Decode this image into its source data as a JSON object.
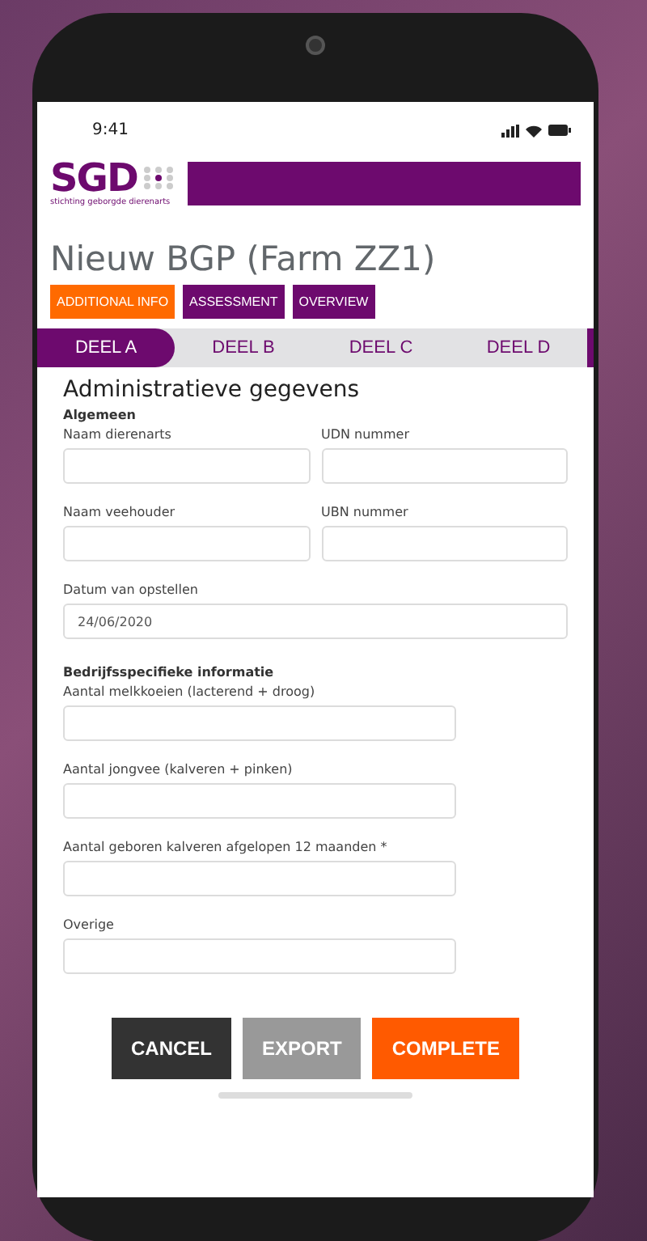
{
  "status_bar": {
    "time": "9:41"
  },
  "logo": {
    "text": "SGD",
    "subtitle": "stichting geborgde dierenarts"
  },
  "title": "Nieuw BGP (Farm ZZ1)",
  "nav_buttons": [
    {
      "label": "ADDITIONAL INFO",
      "selected": true
    },
    {
      "label": "ASSESSMENT",
      "selected": false
    },
    {
      "label": "OVERVIEW",
      "selected": false
    }
  ],
  "tabs": [
    {
      "label": "DEEL A",
      "selected": true
    },
    {
      "label": "DEEL B",
      "selected": false
    },
    {
      "label": "DEEL C",
      "selected": false
    },
    {
      "label": "DEEL D",
      "selected": false
    }
  ],
  "form": {
    "heading": "Administratieve gegevens",
    "sections": [
      {
        "title": "Algemeen",
        "rows": [
          [
            {
              "label": "Naam dierenarts"
            },
            {
              "label": "UDN nummer"
            }
          ],
          [
            {
              "label": "Naam veehouder"
            },
            {
              "label": "UBN nummer"
            }
          ],
          [
            {
              "label": "Datum van opstellen",
              "value": "24/06/2020"
            }
          ]
        ]
      },
      {
        "title": "Bedrijfsspecifieke informatie",
        "rows": [
          [
            {
              "label": "Aantal melkkoeien (lacterend + droog)"
            }
          ],
          [
            {
              "label": "Aantal jongvee (kalveren + pinken)"
            }
          ],
          [
            {
              "label": "Aantal geboren kalveren afgelopen 12 maanden *"
            }
          ],
          [
            {
              "label": "Overige"
            }
          ]
        ]
      }
    ]
  },
  "actions": [
    {
      "label": "CANCEL",
      "kind": "cancel"
    },
    {
      "label": "EXPORT",
      "kind": "export"
    },
    {
      "label": "COMPLETE",
      "kind": "complete"
    }
  ]
}
